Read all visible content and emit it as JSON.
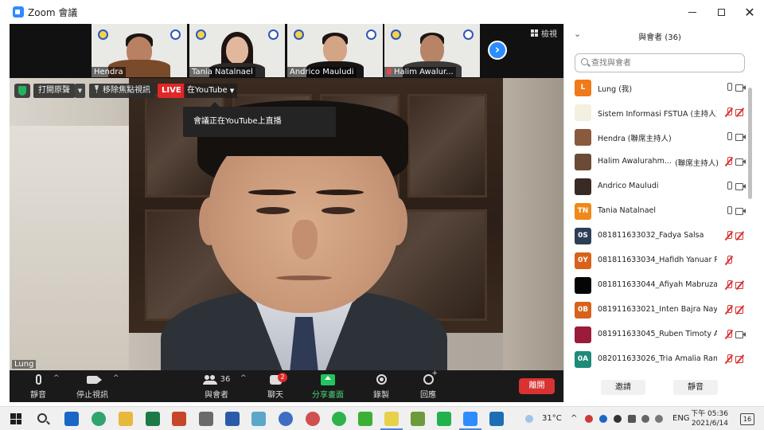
{
  "window": {
    "title": "Zoom 會議"
  },
  "thumbnails": [
    {
      "name": "Hendra",
      "muted": false
    },
    {
      "name": "Tania Natalnael",
      "muted": false
    },
    {
      "name": "Andrico Mauludi",
      "muted": false
    },
    {
      "name": "Halim Awalur...",
      "muted": true
    }
  ],
  "view_button": {
    "label": "檢視"
  },
  "main_video": {
    "speaker": "Lung"
  },
  "overlay": {
    "original_sound": "打開原聲",
    "remove_spotlight": "移除焦點視訊",
    "live_badge": "LIVE",
    "live_where": "在YouTube",
    "tooltip": "會議正在YouTube上直播"
  },
  "toolbar": {
    "mute": "靜音",
    "stop_video": "停止視訊",
    "participants": "與會者",
    "participants_count": "36",
    "chat": "聊天",
    "chat_badge": "2",
    "share": "分享畫面",
    "record": "錄製",
    "reactions": "回應",
    "leave": "離開"
  },
  "panel": {
    "title": "與會者 (36)",
    "search_placeholder": "查找與會者",
    "invite": "邀請",
    "mute_all": "靜音",
    "participants": [
      {
        "initials": "L",
        "color": "#f07a1a",
        "name": "Lung (我)",
        "role": "",
        "mic": "on",
        "cam": "on"
      },
      {
        "initials": "",
        "color": "#f3f0e0",
        "name": "Sistem Informasi FSTUA (主持人)",
        "role": "",
        "mic": "off",
        "cam": "off"
      },
      {
        "initials": "",
        "color": "#8a5a3c",
        "name": "Hendra (聯席主持人)",
        "role": "",
        "mic": "on",
        "cam": "on"
      },
      {
        "initials": "",
        "color": "#6b4a36",
        "name": "Halim Awalurahm...",
        "role": "(聯席主持人)",
        "mic": "off",
        "cam": "on"
      },
      {
        "initials": "",
        "color": "#3a2a24",
        "name": "Andrico Mauludi",
        "role": "",
        "mic": "on",
        "cam": "on"
      },
      {
        "initials": "TN",
        "color": "#f0891a",
        "name": "Tania Natalnael",
        "role": "",
        "mic": "on",
        "cam": "on"
      },
      {
        "initials": "0S",
        "color": "#2d3f55",
        "name": "081811633032_Fadya Salsa",
        "role": "",
        "mic": "off",
        "cam": "off"
      },
      {
        "initials": "0Y",
        "color": "#d8621a",
        "name": "081811633034_Hafidh Yanuar Prasti...",
        "role": "",
        "mic": "off",
        "cam": ""
      },
      {
        "initials": "",
        "color": "#050505",
        "name": "081811633044_Afiyah Mabruzah",
        "role": "",
        "mic": "off",
        "cam": "off"
      },
      {
        "initials": "0B",
        "color": "#d8621a",
        "name": "081911633021_Inten Bajra Nay...",
        "role": "",
        "mic": "off",
        "cam": "off"
      },
      {
        "initials": "",
        "color": "#9b1c3a",
        "name": "081911633045_Ruben Timoty A...",
        "role": "",
        "mic": "off",
        "cam": "on"
      },
      {
        "initials": "0A",
        "color": "#1f8a7a",
        "name": "082011633026_Tria Amalia Ram...",
        "role": "",
        "mic": "off",
        "cam": "off"
      }
    ]
  },
  "taskbar": {
    "temperature": "31°C",
    "language": "ENG",
    "time": "下午 05:36",
    "date": "2021/6/14",
    "notifications": "16"
  }
}
